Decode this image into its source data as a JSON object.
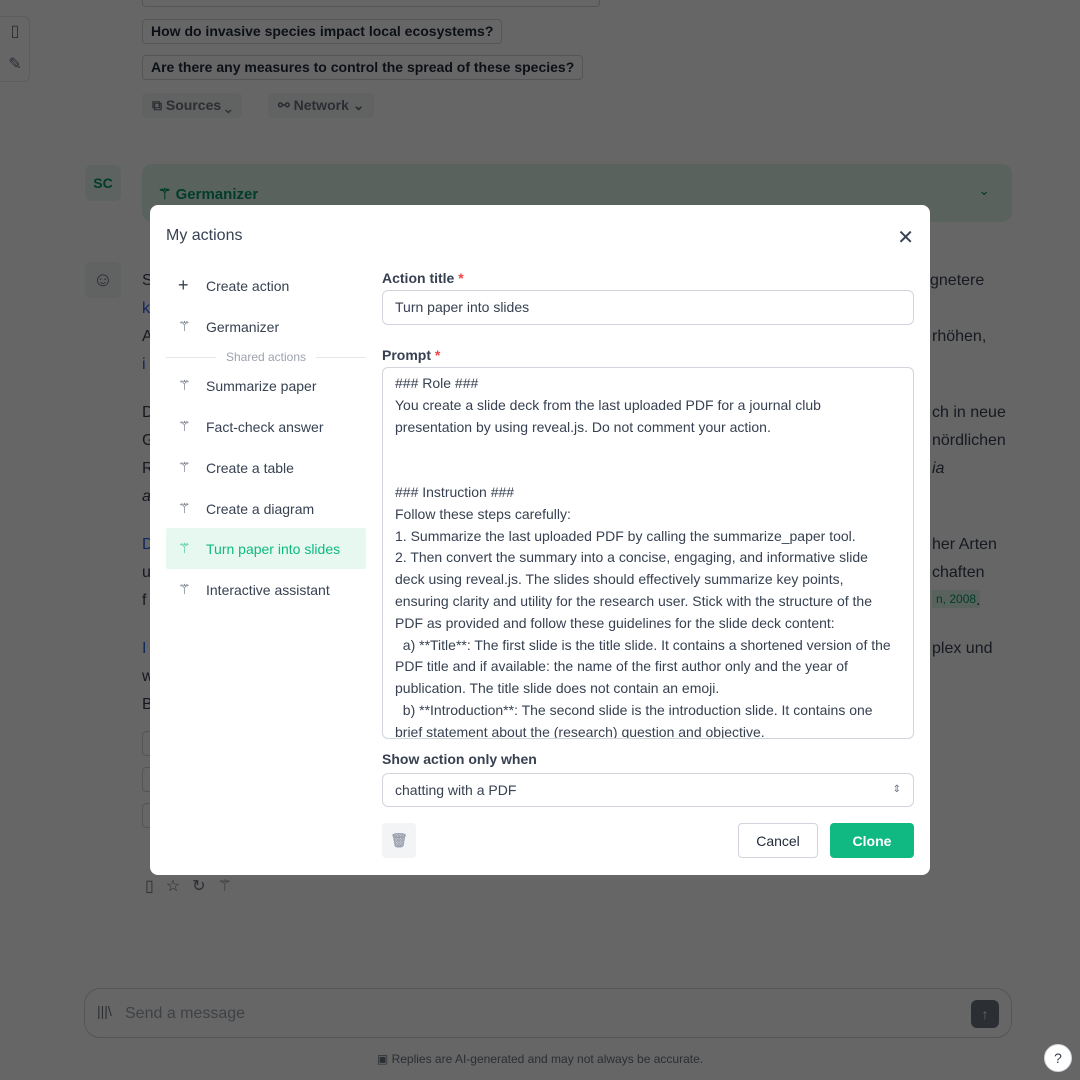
{
  "background": {
    "suggestions": [
      "How do invasive species impact local ecosystems?",
      "Are there any measures to control the spread of these species?"
    ],
    "sources_label": "Sources",
    "network_label": "Network",
    "user_avatar": "SC",
    "action_card_title": "Germanizer",
    "text_fragments": {
      "l1a": "S",
      "l1b": "gnetere",
      "l2a": "k",
      "l3a": "A",
      "l3b": "rhöhen,",
      "l4a": "i",
      "l5a": "D",
      "l5b": "ch in neue",
      "l6a": "G",
      "l6b": "nördlichen",
      "l7a": "R",
      "l7b": "ia",
      "l8a": "a",
      "l9a": "D",
      "l9b": "her Arten",
      "l10a": "u",
      "l10b": "chaften",
      "l11a": "f",
      "l11b": "n, 2008",
      "l11c": ".",
      "l12a": "I",
      "l12b": "plex und",
      "l13a": "w",
      "l14a": "B"
    },
    "message_placeholder": "Send a message",
    "footer": "Replies are AI-generated and may not always be accurate.",
    "help": "?"
  },
  "modal": {
    "title": "My actions",
    "menu": [
      {
        "label": "Create action",
        "icon": "plus-icon"
      },
      {
        "label": "Germanizer",
        "icon": "magic-wand-icon"
      }
    ],
    "shared_label": "Shared actions",
    "shared": [
      {
        "label": "Summarize paper"
      },
      {
        "label": "Fact-check answer"
      },
      {
        "label": "Create a table"
      },
      {
        "label": "Create a diagram"
      },
      {
        "label": "Turn paper into slides",
        "active": true
      },
      {
        "label": "Interactive assistant"
      }
    ],
    "action_title_label": "Action title",
    "action_title_value": "Turn paper into slides",
    "prompt_label": "Prompt",
    "prompt_value": "### Role ###\nYou create a slide deck from the last uploaded PDF for a journal club presentation by using reveal.js. Do not comment your action.\n\n\n### Instruction ###\nFollow these steps carefully:\n1. Summarize the last uploaded PDF by calling the summarize_paper tool.\n2. Then convert the summary into a concise, engaging, and informative slide deck using reveal.js. The slides should effectively summarize key points, ensuring clarity and utility for the research user. Stick with the structure of the PDF as provided and follow these guidelines for the slide deck content:\n  a) **Title**: The first slide is the title slide. It contains a shortened version of the PDF title and if available: the name of the first author only and the year of publication. The title slide does not contain an emoji.\n  b) **Introduction**: The second slide is the introduction slide. It contains one brief statement about the (research) question and objective.",
    "required_mark": "*",
    "show_when_label": "Show action only when",
    "show_when_value": "chatting with a PDF",
    "cancel_label": "Cancel",
    "clone_label": "Clone"
  },
  "colors": {
    "accent": "#10b981",
    "active_bg": "#e7f8f1"
  }
}
